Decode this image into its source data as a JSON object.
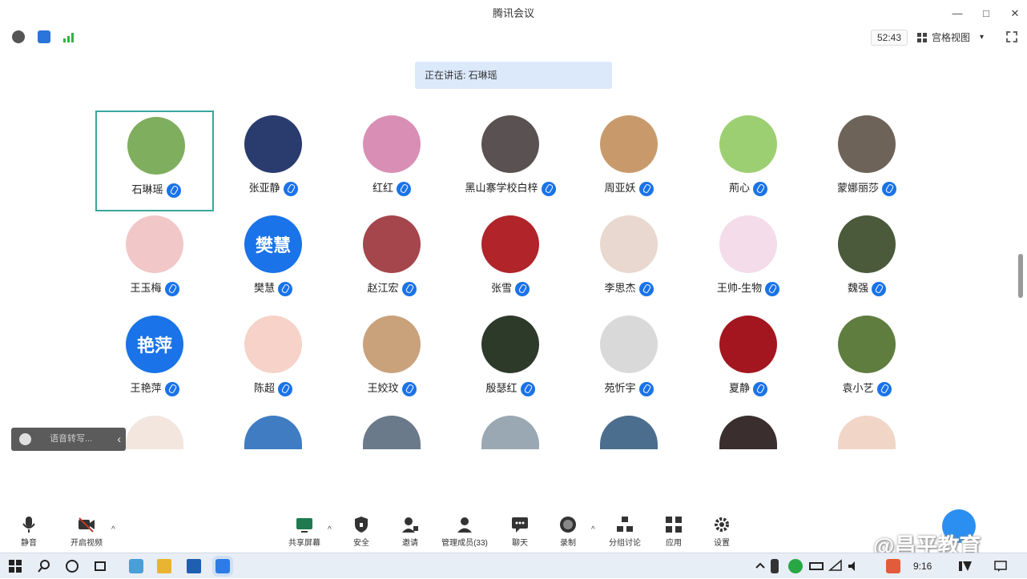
{
  "window": {
    "title": "腾讯会议",
    "controls": [
      "—",
      "□",
      "✕"
    ]
  },
  "topbar": {
    "timer": "52:43",
    "view_label": "宫格视图",
    "view_caret": "▾"
  },
  "speaking_banner": "正在讲话: 石琳瑶",
  "participants": [
    {
      "name": "石琳瑶",
      "avatar_color": "#7fae5e"
    },
    {
      "name": "张亚静",
      "avatar_color": "#2a3b6e"
    },
    {
      "name": "红红",
      "avatar_color": "#d98fb5"
    },
    {
      "name": "黑山寨学校白梓",
      "avatar_color": "#5a5252"
    },
    {
      "name": "周亚妖",
      "avatar_color": "#c89a6b"
    },
    {
      "name": "荊心",
      "avatar_color": "#9ccf71"
    },
    {
      "name": "蒙娜丽莎",
      "avatar_color": "#6d6358"
    },
    {
      "name": "王玉梅",
      "avatar_color": "#f2c7c7"
    },
    {
      "name": "樊慧",
      "avatar_text": "樊慧"
    },
    {
      "name": "赵江宏",
      "avatar_color": "#a5464c"
    },
    {
      "name": "张雪",
      "avatar_color": "#b0242a"
    },
    {
      "name": "李思杰",
      "avatar_color": "#e8d8cf"
    },
    {
      "name": "王帅-生物",
      "avatar_color": "#f4dcea"
    },
    {
      "name": "魏强",
      "avatar_color": "#4a5a3a"
    },
    {
      "name": "王艳萍",
      "avatar_text": "艳萍"
    },
    {
      "name": "陈超",
      "avatar_color": "#f6d2c8"
    },
    {
      "name": "王姣玟",
      "avatar_color": "#c9a27c"
    },
    {
      "name": "殷瑟红",
      "avatar_color": "#2d3a2a"
    },
    {
      "name": "苑忻宇",
      "avatar_color": "#d9d9d9"
    },
    {
      "name": "夏静",
      "avatar_color": "#a3161f"
    },
    {
      "name": "袁小艺",
      "avatar_color": "#5e7d3f"
    }
  ],
  "partial_row_colors": [
    "#f2e6df",
    "#3f7cc2",
    "#6b7a8a",
    "#9aa8b3",
    "#4c6e8e",
    "#3b2e2e",
    "#f1d6c8"
  ],
  "floating_panel": {
    "text": "语音转写...",
    "collapse": "‹"
  },
  "bottom_toolbar": [
    {
      "label": "静音",
      "icon": "mic-icon"
    },
    {
      "label": "开启视频",
      "icon": "video-icon"
    },
    {
      "label": "共享屏幕",
      "icon": "share-screen-icon"
    },
    {
      "label": "安全",
      "icon": "shield-icon"
    },
    {
      "label": "邀请",
      "icon": "invite-icon"
    },
    {
      "label": "管理成员(33)",
      "icon": "members-icon"
    },
    {
      "label": "聊天",
      "icon": "chat-icon"
    },
    {
      "label": "录制",
      "icon": "record-icon"
    },
    {
      "label": "分组讨论",
      "icon": "breakout-icon"
    },
    {
      "label": "应用",
      "icon": "apps-icon"
    },
    {
      "label": "设置",
      "icon": "gear-icon"
    }
  ],
  "watermark": "@昌平教育",
  "taskbar": {
    "time": "9:16"
  },
  "colors": {
    "accent": "#1a73e8",
    "active_border": "#3aa79c",
    "banner_bg": "#dbe9fb"
  }
}
